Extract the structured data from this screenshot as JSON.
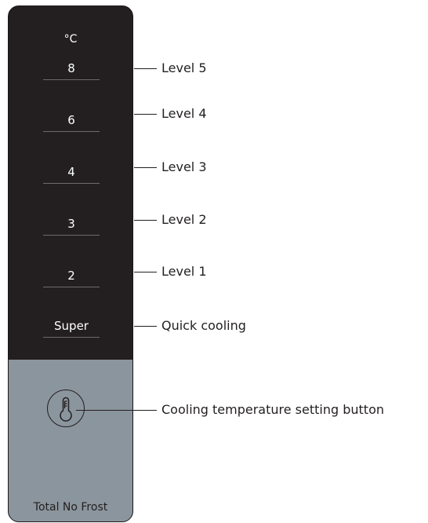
{
  "panel": {
    "unit": "°C",
    "levels": [
      {
        "value": "8",
        "callout": "Level 5"
      },
      {
        "value": "6",
        "callout": "Level 4"
      },
      {
        "value": "4",
        "callout": "Level 3"
      },
      {
        "value": "3",
        "callout": "Level 2"
      },
      {
        "value": "2",
        "callout": "Level 1"
      },
      {
        "value": "Super",
        "callout": "Quick cooling"
      }
    ],
    "button_callout": "Cooling temperature setting button",
    "brand": "Total No Frost"
  },
  "colors": {
    "panel_dark": "#231f20",
    "panel_bottom": "#8b959d",
    "text_light": "#ffffff",
    "ink": "#231f20"
  },
  "icons": {
    "button": "thermometer-icon"
  }
}
